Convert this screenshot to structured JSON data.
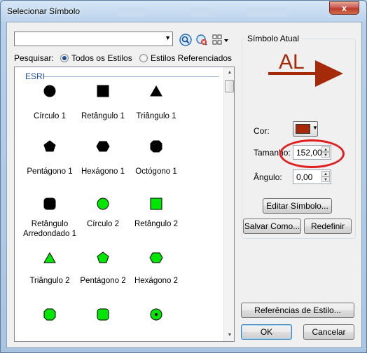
{
  "window": {
    "title": "Selecionar Símbolo",
    "close_glyph": "x"
  },
  "search": {
    "value": "",
    "label": "Pesquisar:",
    "option_all": "Todos os Estilos",
    "option_referenced": "Estilos Referenciados",
    "selected": "all"
  },
  "toolbar": {
    "icons": [
      "search-icon",
      "clear-search-icon",
      "view-options-icon"
    ]
  },
  "list": {
    "group": "ESRI",
    "symbols": [
      {
        "label": "Círculo 1",
        "shape": "circle",
        "color": "#000000"
      },
      {
        "label": "Retângulo 1",
        "shape": "square",
        "color": "#000000"
      },
      {
        "label": "Triângulo 1",
        "shape": "triangle",
        "color": "#000000"
      },
      {
        "label": "Pentágono 1",
        "shape": "pentagon",
        "color": "#000000"
      },
      {
        "label": "Hexágono 1",
        "shape": "hexagon",
        "color": "#000000"
      },
      {
        "label": "Octógono 1",
        "shape": "octagon",
        "color": "#000000"
      },
      {
        "label": "Retângulo Arredondado 1",
        "shape": "rounded-square",
        "color": "#000000"
      },
      {
        "label": "Círculo 2",
        "shape": "circle",
        "color": "#00e600"
      },
      {
        "label": "Retângulo 2",
        "shape": "square",
        "color": "#00e600"
      },
      {
        "label": "Triângulo 2",
        "shape": "triangle",
        "color": "#00e600"
      },
      {
        "label": "Pentágono 2",
        "shape": "pentagon",
        "color": "#00e600"
      },
      {
        "label": "Hexágono 2",
        "shape": "hexagon",
        "color": "#00e600"
      },
      {
        "label": "",
        "shape": "octagon",
        "color": "#00e600"
      },
      {
        "label": "",
        "shape": "rounded-square",
        "color": "#00e600"
      },
      {
        "label": "",
        "shape": "circle-dot",
        "color": "#00e600"
      }
    ]
  },
  "current": {
    "title": "Símbolo Atual",
    "preview_text": "AL",
    "preview_color": "#a52a0a",
    "color_label": "Cor:",
    "color_value": "#a52a0a",
    "size_label": "Tamanho:",
    "size_value": "152,00",
    "angle_label": "Ângulo:",
    "angle_value": "0,00"
  },
  "buttons": {
    "edit_symbol": "Editar Símbolo...",
    "save_as": "Salvar Como...",
    "reset": "Redefinir",
    "style_references": "Referências de Estilo...",
    "ok": "OK",
    "cancel": "Cancelar"
  },
  "highlight_color": "#e02020"
}
